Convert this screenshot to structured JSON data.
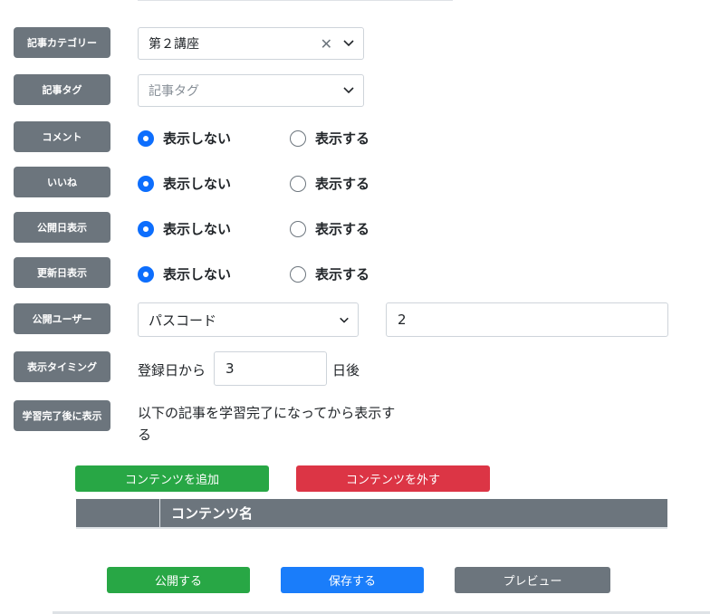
{
  "fields": {
    "category": {
      "label": "記事カテゴリー",
      "value": "第２講座"
    },
    "tag": {
      "label": "記事タグ",
      "placeholder": "記事タグ"
    },
    "comment": {
      "label": "コメント",
      "option_off": "表示しない",
      "option_on": "表示する",
      "selected": "表示しない"
    },
    "like": {
      "label": "いいね",
      "option_off": "表示しない",
      "option_on": "表示する",
      "selected": "表示しない"
    },
    "publish_date": {
      "label": "公開日表示",
      "option_off": "表示しない",
      "option_on": "表示する",
      "selected": "表示しない"
    },
    "update_date": {
      "label": "更新日表示",
      "option_off": "表示しない",
      "option_on": "表示する",
      "selected": "表示しない"
    },
    "public_user": {
      "label": "公開ユーザー",
      "select_value": "パスコード",
      "input_value": "2"
    },
    "display_timing": {
      "label": "表示タイミング",
      "prefix": "登録日から",
      "value": "3",
      "suffix": "日後"
    },
    "after_complete": {
      "label": "学習完了後に表示",
      "description_line1": "以下の記事を学習完了になってから表示す",
      "description_line2": "る"
    }
  },
  "contents": {
    "add_button": "コンテンツを追加",
    "remove_button": "コンテンツを外す",
    "column_name": "コンテンツ名"
  },
  "footer": {
    "publish_button": "公開する",
    "save_button": "保存する",
    "preview_button": "プレビュー"
  },
  "colors": {
    "badge": "#6c757d",
    "primary": "#0d6efd",
    "success": "#28a745",
    "danger": "#dc3545"
  }
}
